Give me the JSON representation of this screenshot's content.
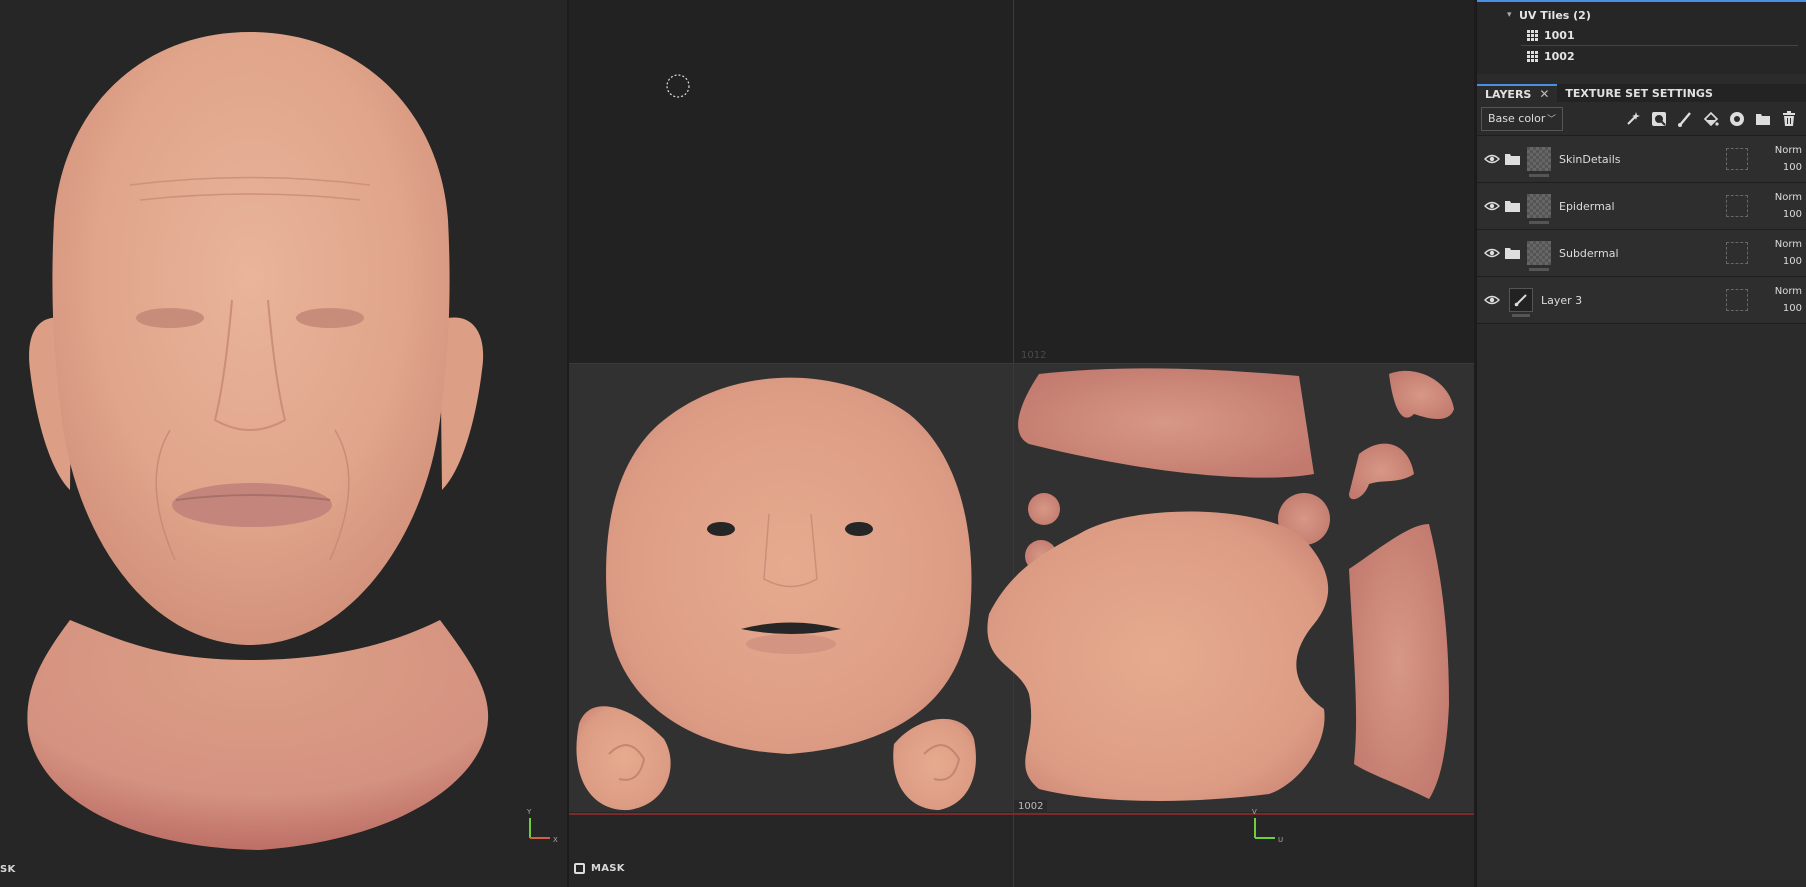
{
  "viewport3d": {
    "label": "SK",
    "axis_y": "Y",
    "axis_x": "X"
  },
  "uv_view": {
    "mask_label": "MASK",
    "tile_top_label": "1012",
    "tile_bottom_label": "1002",
    "axis_v": "V",
    "axis_u": "U"
  },
  "panel": {
    "uv_tiles": {
      "group_label": "UV Tiles (2)",
      "items": [
        "1001",
        "1002"
      ]
    },
    "tabs": [
      {
        "label": "LAYERS",
        "active": true
      },
      {
        "label": "TEXTURE SET SETTINGS",
        "active": false
      }
    ],
    "channel_select": "Base color",
    "layers": [
      {
        "name": "SkinDetails",
        "type": "folder",
        "blend": "Norm",
        "opacity": "100"
      },
      {
        "name": "Epidermal",
        "type": "folder",
        "blend": "Norm",
        "opacity": "100"
      },
      {
        "name": "Subdermal",
        "type": "folder",
        "blend": "Norm",
        "opacity": "100"
      },
      {
        "name": "Layer 3",
        "type": "paint",
        "blend": "Norm",
        "opacity": "100"
      }
    ]
  },
  "colors": {
    "accent": "#4a90e2",
    "skin": "#e2a88a",
    "skin_red": "#c87a6e",
    "uv_border": "#7a2a2a"
  }
}
